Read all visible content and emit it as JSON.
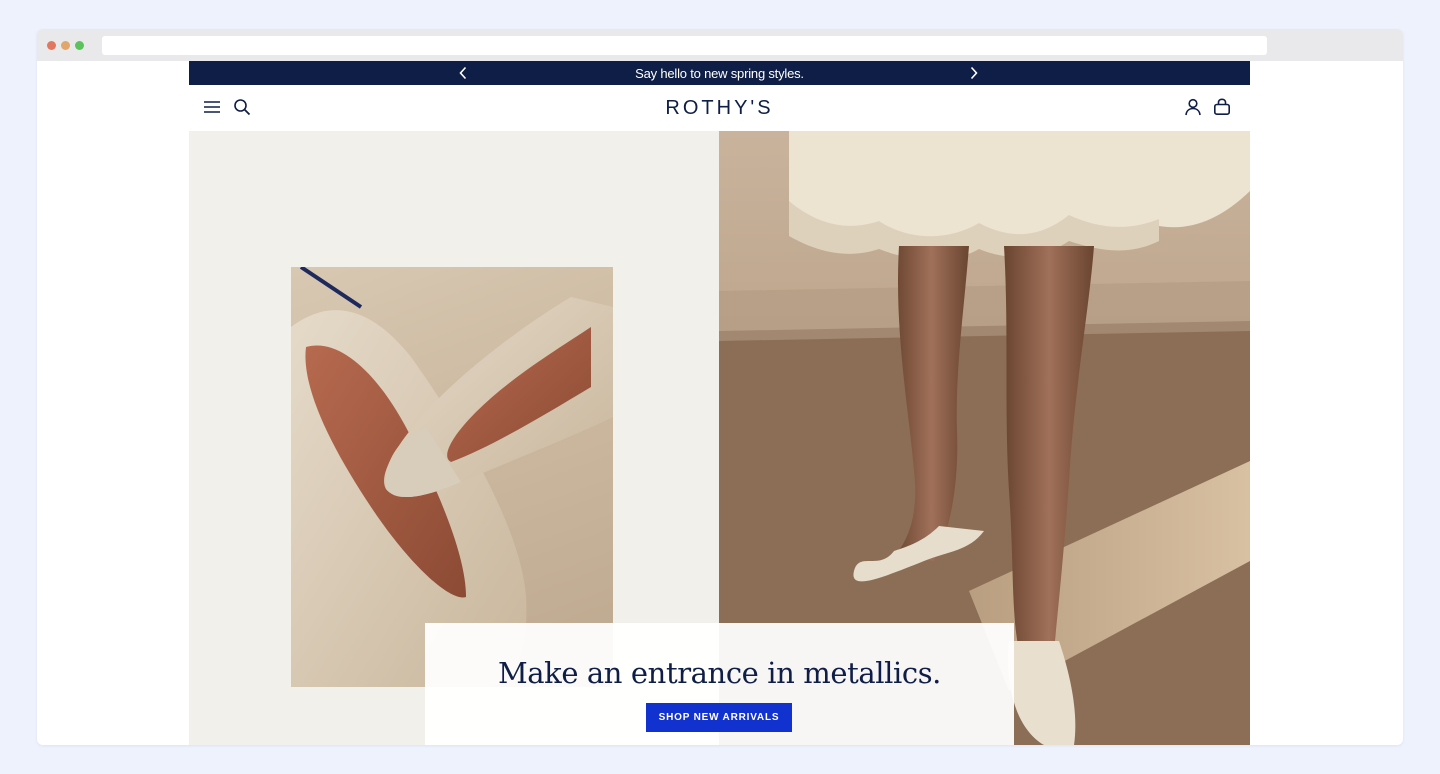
{
  "promo": {
    "message": "Say hello to new spring styles."
  },
  "header": {
    "logo": "ROTHY'S"
  },
  "hero": {
    "heading": "Make an entrance in metallics.",
    "cta_label": "SHOP NEW ARRIVALS"
  },
  "colors": {
    "navy": "#0f1e46",
    "cta_blue": "#1232d0",
    "cream": "#f2f0ea"
  },
  "icons": [
    "menu-icon",
    "search-icon",
    "account-icon",
    "bag-icon",
    "chevron-left-icon",
    "chevron-right-icon"
  ]
}
